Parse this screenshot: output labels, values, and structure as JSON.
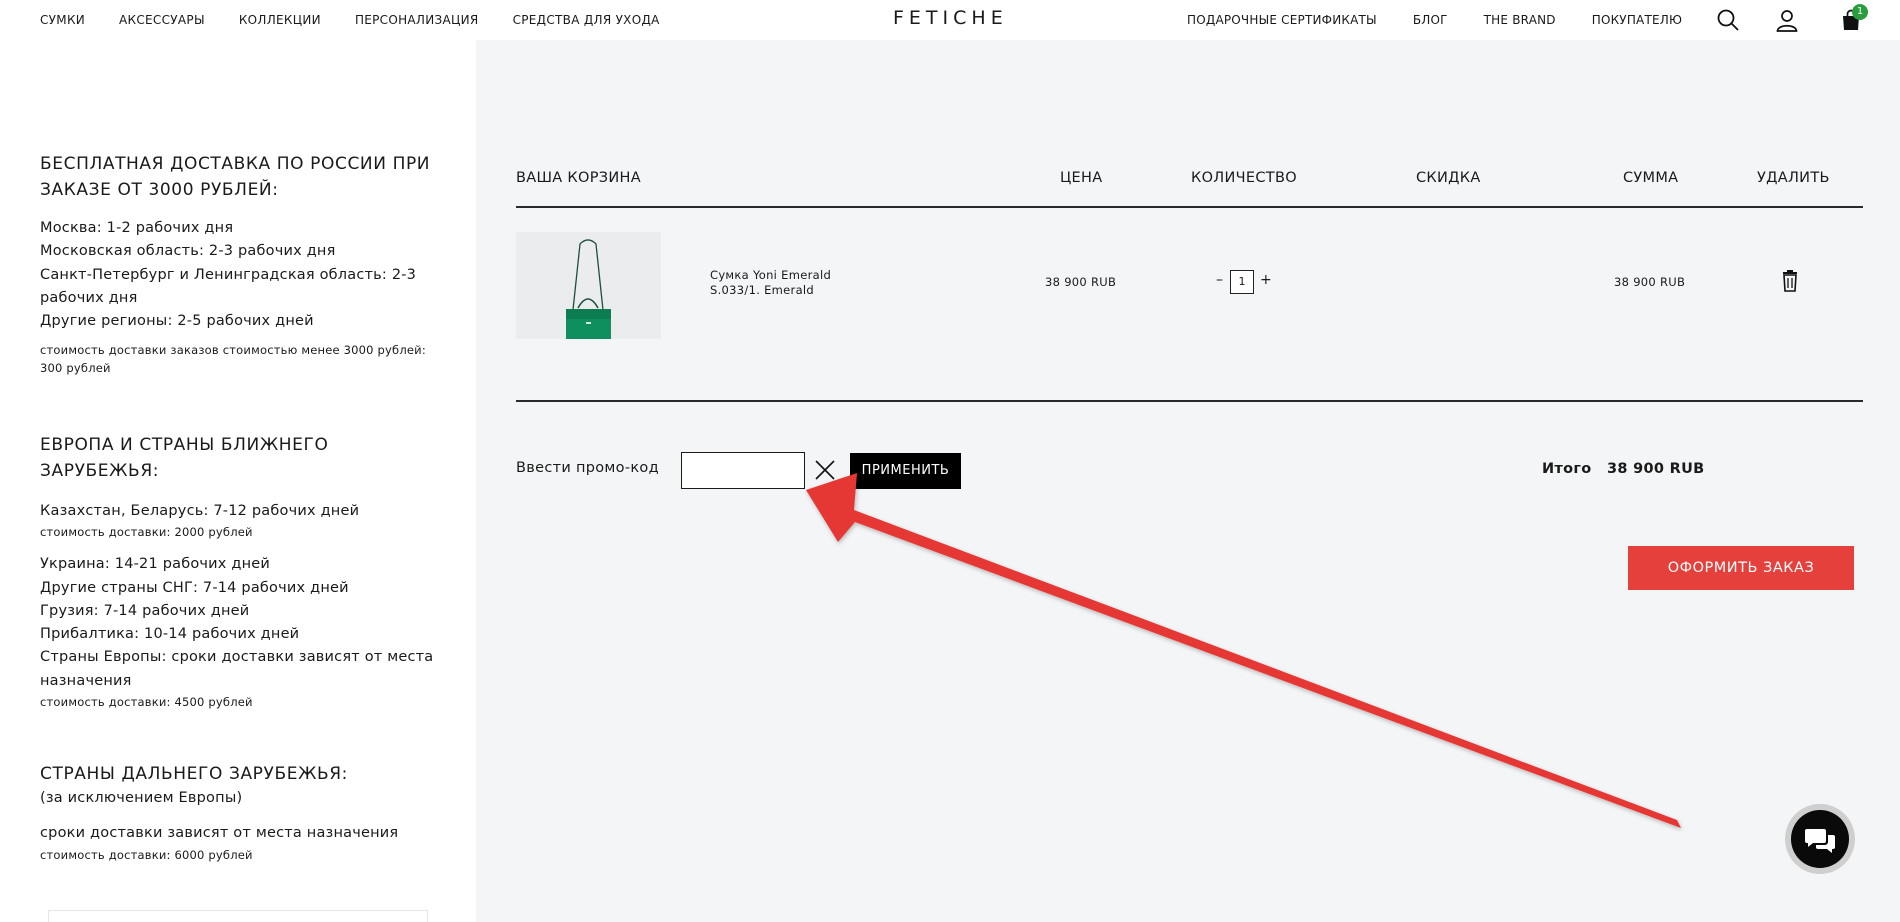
{
  "header": {
    "nav_left": [
      "СУМКИ",
      "АКСЕССУАРЫ",
      "КОЛЛЕКЦИИ",
      "ПЕРСОНАЛИЗАЦИЯ",
      "СРЕДСТВА ДЛЯ УХОДА"
    ],
    "logo": "FETICHE",
    "nav_right": [
      "ПОДАРОЧНЫЕ СЕРТИФИКАТЫ",
      "БЛОГ",
      "THE BRAND",
      "ПОКУПАТЕЛЮ"
    ],
    "cart_count": "1",
    "icons": [
      "search-icon",
      "user-icon",
      "shopping-bag-icon"
    ]
  },
  "sidebar": {
    "russia": {
      "title": "БЕСПЛАТНАЯ ДОСТАВКА ПО РОССИИ ПРИ ЗАКАЗЕ ОТ 3000 РУБЛЕЙ:",
      "lines": [
        "Москва: 1-2 рабочих дня",
        "Московская область: 2-3 рабочих дня",
        "Санкт-Петербург и Ленинградская область: 2-3 рабочих дня",
        "Другие регионы: 2-5 рабочих дней"
      ],
      "note": "стоимость доставки заказов стоимостью менее 3000 рублей: 300 рублей"
    },
    "europe": {
      "title": "ЕВРОПА И СТРАНЫ БЛИЖНЕГО ЗАРУБЕЖЬЯ:",
      "kz_line": "Казахстан, Беларусь: 7-12 рабочих дней",
      "kz_note": "стоимость доставки: 2000 рублей",
      "lines": [
        "Украина: 14-21 рабочих дней",
        "Другие страны СНГ: 7-14 рабочих дней",
        "Грузия: 7-14 рабочих дней",
        "Прибалтика: 10-14 рабочих дней",
        "Страны Европы: сроки доставки зависят от места назначения"
      ],
      "note": "стоимость доставки: 4500 рублей"
    },
    "far": {
      "title": "СТРАНЫ ДАЛЬНЕГО ЗАРУБЕЖЬЯ:",
      "subtitle": "(за исключением Европы)",
      "line": "сроки доставки зависят от места назначения",
      "note": "стоимость доставки: 6000 рублей"
    }
  },
  "cart": {
    "headers": {
      "cart": "ВАША КОРЗИНА",
      "price": "ЦЕНА",
      "quantity": "КОЛИЧЕСТВО",
      "discount": "СКИДКА",
      "sum": "СУММА",
      "delete": "УДАЛИТЬ"
    },
    "items": [
      {
        "name": "Сумка Yoni Emerald",
        "sku": "S.033/1. Emerald",
        "price": "38 900 RUB",
        "quantity": "1",
        "sum": "38 900  RUB"
      }
    ],
    "qty_minus": "–",
    "qty_plus": "+",
    "promo_label": "Ввести промо-код",
    "promo_value": "",
    "apply_label": "ПРИМЕНИТЬ",
    "total_label": "Итого",
    "total_value": "38 900 RUB",
    "checkout_label": "ОФОРМИТЬ ЗАКАЗ"
  },
  "colors": {
    "accent_red": "#e5403b",
    "arrow_red": "#e53935",
    "product_green": "#0f8f5e",
    "badge_green": "#2a9d3f"
  }
}
